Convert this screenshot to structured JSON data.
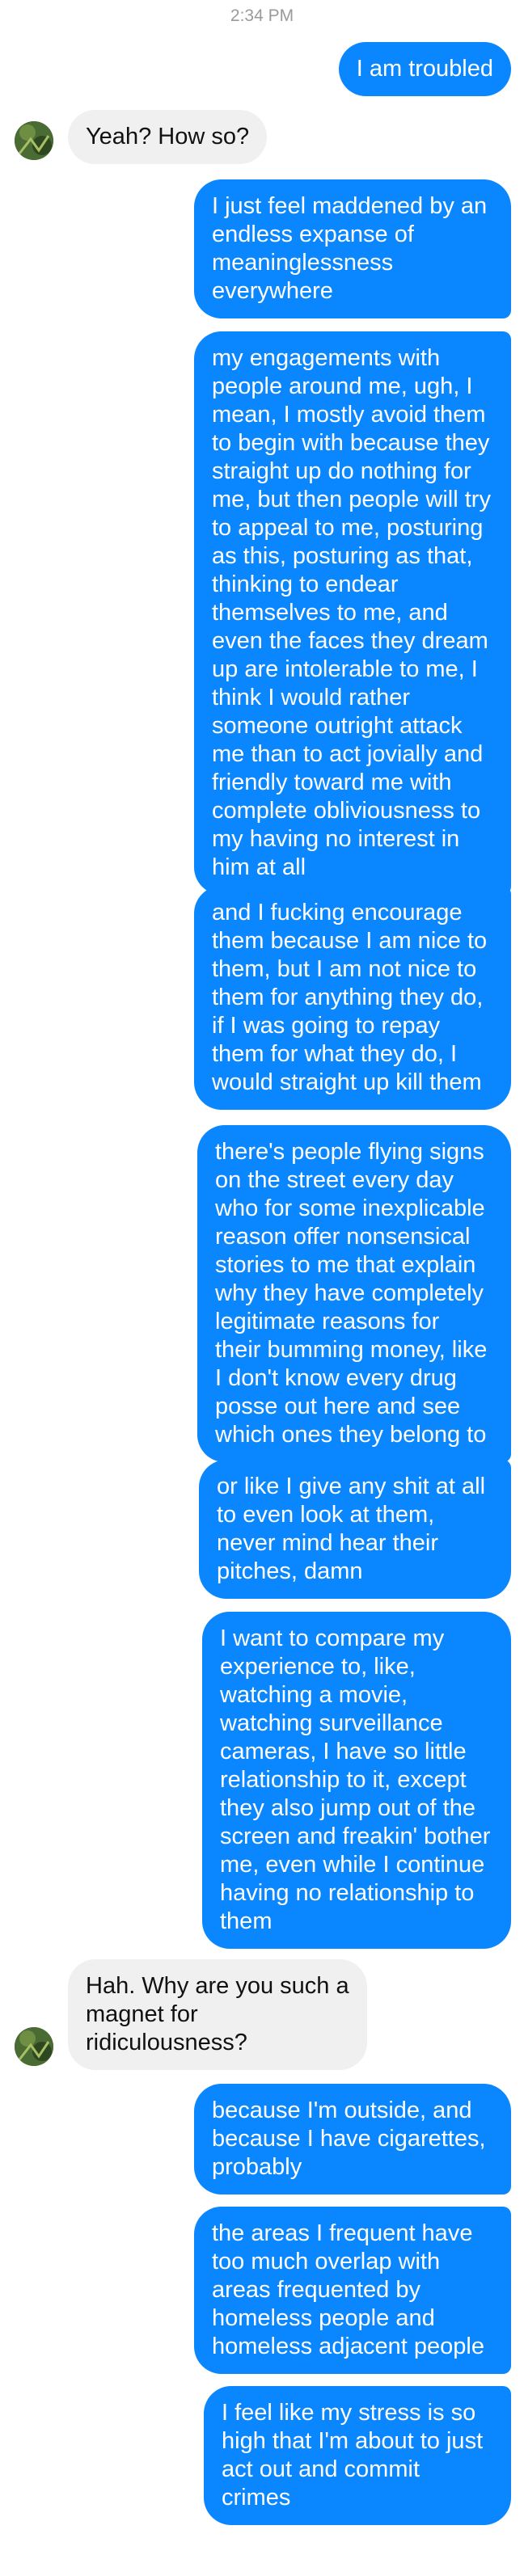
{
  "header": {
    "timestamp": "2:34 PM"
  },
  "messages": [
    {
      "sender": "me",
      "text": "I am troubled"
    },
    {
      "sender": "them",
      "text": "Yeah? How so?"
    },
    {
      "sender": "me",
      "text": "I just feel maddened by an\nendless expanse of\nmeaninglessness\neverywhere"
    },
    {
      "sender": "me",
      "text": "my engagements with\npeople around me, ugh, I\nmean, I mostly avoid them\nto begin with because they\nstraight up do nothing for\nme, but then people will try\nto appeal to me, posturing\nas this, posturing as that,\nthinking to endear\nthemselves to me, and\neven the faces they dream\nup are intolerable to me, I\nthink I would rather\nsomeone outright attack\nme than to act jovially and\nfriendly toward me with\ncomplete obliviousness to\nmy having no interest in\nhim at all"
    },
    {
      "sender": "me",
      "text": "and I fucking encourage\nthem because I am nice to\nthem, but I am not nice to\nthem for anything they do,\nif I was going to repay\nthem for what they do, I\nwould straight up kill them"
    },
    {
      "sender": "me",
      "text": "there's people flying signs\non the street every day\nwho for some inexplicable\nreason offer nonsensical\nstories to me that explain\nwhy they have completely\nlegitimate reasons for\ntheir bumming money, like\nI don't know every drug\nposse out here and see\nwhich ones they belong to"
    },
    {
      "sender": "me",
      "text": "or like I give any shit at all\nto even look at them,\nnever mind hear their\npitches, damn"
    },
    {
      "sender": "me",
      "text": "I want to compare my\nexperience to, like,\nwatching a movie,\nwatching surveillance\ncameras, I have so little\nrelationship to it, except\nthey also jump out of the\nscreen and freakin' bother\nme, even while I continue\nhaving no relationship to\nthem"
    },
    {
      "sender": "them",
      "text": "Hah. Why are you such a\nmagnet for\nridiculousness?"
    },
    {
      "sender": "me",
      "text": "because I'm outside, and\nbecause I have cigarettes,\nprobably"
    },
    {
      "sender": "me",
      "text": "the areas I frequent have\ntoo much overlap with\nareas frequented by\nhomeless people and\nhomeless adjacent people"
    },
    {
      "sender": "me",
      "text": "I feel like my stress is so\nhigh that I'm about to just\nact out and commit\ncrimes"
    }
  ],
  "colors": {
    "outgoing": "#0a86ff",
    "incoming": "#f1f0f0",
    "timestamp": "#9a9a9a"
  },
  "icons": {
    "contact_avatar": "contact-avatar-icon"
  }
}
